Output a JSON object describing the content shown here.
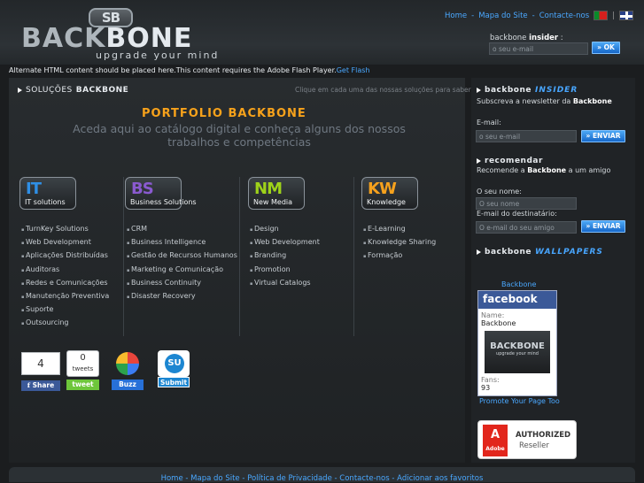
{
  "header": {
    "logo_emblem": "SB",
    "logo_word_1": "BACK",
    "logo_word_2": "BONE",
    "logo_tagline": "upgrade your mind",
    "nav": [
      "Home",
      "Mapa do Site",
      "Contacte-nos"
    ],
    "lang_sep": "|",
    "insider_prefix": "backbone ",
    "insider_bold": "insider",
    "insider_suffix": " :",
    "insider_placeholder": "o seu e-mail",
    "insider_ok": "OK"
  },
  "flash": {
    "text": "Alternate HTML content should be placed here.This content requires the Adobe Flash Player.",
    "link": "Get Flash"
  },
  "solutions": {
    "title_prefix": "SOLUÇÕES ",
    "title_bold": "BACKBONE",
    "hint": "Clique em cada uma das nossas soluções para saber mais",
    "portfolio": "PORTFOLIO BACKBONE",
    "portfolio_sub": "Aceda aqui ao catálogo digital e conheça alguns dos nossos trabalhos e competências",
    "categories": [
      {
        "abbr": "IT",
        "name": "IT solutions",
        "color": "#2e8fe6",
        "items": [
          "TurnKey Solutions",
          "Web Development",
          "Aplicações Distribuídas",
          "Auditoras",
          "Redes e Comunicações",
          "Manutenção Preventiva",
          "Suporte",
          "Outsourcing"
        ]
      },
      {
        "abbr": "BS",
        "name": "Business Solutions",
        "color": "#8a5ad0",
        "items": [
          "CRM",
          "Business Intelligence",
          "Gestão de Recursos Humanos",
          "Marketing e Comunicação",
          "Business Continuity",
          "Disaster Recovery"
        ]
      },
      {
        "abbr": "NM",
        "name": "New Media",
        "color": "#9ed21a",
        "items": [
          "Design",
          "Web Development",
          "Branding",
          "Promotion",
          "Virtual Catalogs"
        ]
      },
      {
        "abbr": "KW",
        "name": "Knowledge",
        "color": "#f5a11d",
        "items": [
          "E-Learning",
          "Knowledge Sharing",
          "Formação"
        ]
      }
    ]
  },
  "social": {
    "fb_count": "4",
    "fb_label": "Share",
    "tw_count": "0",
    "tw_unit": "tweets",
    "tw_label": "tweet",
    "google_label": "Buzz",
    "su_label": "Submit",
    "su_icon": "SU"
  },
  "sidebar": {
    "insider_title": "backbone",
    "insider_hl": "INSIDER",
    "insider_desc_prefix": "Subscreva a newsletter da ",
    "insider_desc_bold": "Backbone",
    "email_label": "E-mail:",
    "email_placeholder": "o seu e-mail",
    "send_label": "ENVIAR",
    "recommend_title": "recomendar",
    "recommend_desc_prefix": "Recomende a ",
    "recommend_desc_bold": "Backbone",
    "recommend_desc_suffix": " a um amigo",
    "name_label": "O seu nome:",
    "name_placeholder": "O seu nome",
    "dest_label": "E-mail do destinatário:",
    "dest_placeholder": "O e-mail do seu amigo",
    "send2_label": "ENVIAR",
    "wallpapers_title": "backbone",
    "wallpapers_hl": "WALLPAPERS",
    "fb_page_link": "Backbone",
    "fb_brand": "facebook",
    "fb_name_label": "Name:",
    "fb_name": "Backbone",
    "fb_img_text": "BACKBONE",
    "fb_img_tag": "upgrade your mind",
    "fb_fans_label": "Fans:",
    "fb_fans": "93",
    "fb_promote": "Promote Your Page Too",
    "adobe_brand": "Adobe",
    "adobe_line1": "AUTHORIZED",
    "adobe_line2": "Reseller"
  },
  "footer": {
    "links": [
      "Home",
      "Mapa do Site",
      "Política de Privacidade",
      "Contacte-nos",
      "Adicionar aos favoritos"
    ]
  }
}
